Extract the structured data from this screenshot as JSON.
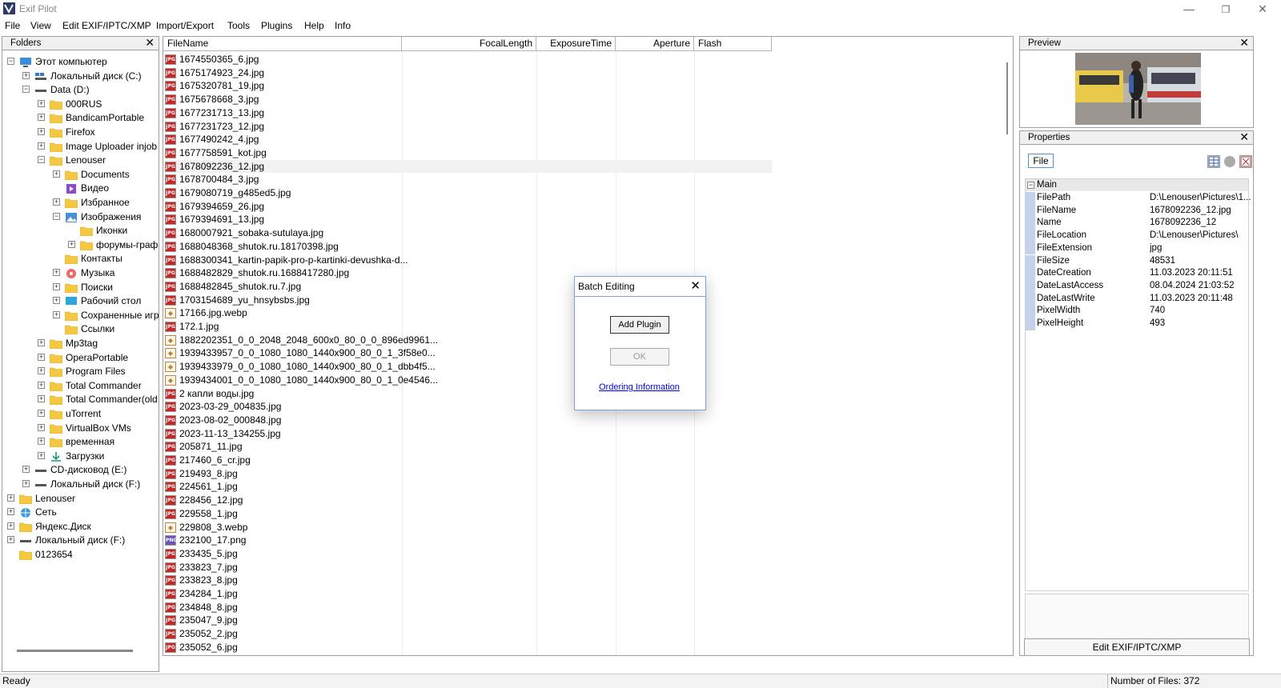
{
  "window": {
    "title": "Exif Pilot"
  },
  "menu": [
    "File",
    "View",
    "Edit EXIF/IPTC/XMP",
    "Import/Export",
    "Tools",
    "Plugins",
    "Help",
    "Info"
  ],
  "folders": {
    "title": "Folders",
    "tree": [
      {
        "label": "Этот компьютер",
        "level": 0,
        "exp": "-",
        "icon": "computer"
      },
      {
        "label": "Локальный диск (C:)",
        "level": 1,
        "exp": "+",
        "icon": "drive-c"
      },
      {
        "label": "Data (D:)",
        "level": 1,
        "exp": "-",
        "icon": "drive"
      },
      {
        "label": "000RUS",
        "level": 2,
        "exp": "+",
        "icon": "folder"
      },
      {
        "label": "BandicamPortable",
        "level": 2,
        "exp": "+",
        "icon": "folder"
      },
      {
        "label": "Firefox",
        "level": 2,
        "exp": "+",
        "icon": "folder"
      },
      {
        "label": "Image Uploader injob",
        "level": 2,
        "exp": "+",
        "icon": "folder"
      },
      {
        "label": "Lenouser",
        "level": 2,
        "exp": "-",
        "icon": "folder"
      },
      {
        "label": "Documents",
        "level": 3,
        "exp": "+",
        "icon": "folder"
      },
      {
        "label": "Видео",
        "level": 3,
        "exp": "",
        "icon": "video"
      },
      {
        "label": "Избранное",
        "level": 3,
        "exp": "+",
        "icon": "folder"
      },
      {
        "label": "Изображения",
        "level": 3,
        "exp": "-",
        "icon": "pictures"
      },
      {
        "label": "Иконки",
        "level": 4,
        "exp": "",
        "icon": "folder"
      },
      {
        "label": "форумы-граф",
        "level": 4,
        "exp": "+",
        "icon": "folder"
      },
      {
        "label": "Контакты",
        "level": 3,
        "exp": "",
        "icon": "folder"
      },
      {
        "label": "Музыка",
        "level": 3,
        "exp": "+",
        "icon": "music"
      },
      {
        "label": "Поиски",
        "level": 3,
        "exp": "+",
        "icon": "folder"
      },
      {
        "label": "Рабочий стол",
        "level": 3,
        "exp": "+",
        "icon": "desktop"
      },
      {
        "label": "Сохраненные игр",
        "level": 3,
        "exp": "+",
        "icon": "folder"
      },
      {
        "label": "Ссылки",
        "level": 3,
        "exp": "",
        "icon": "folder"
      },
      {
        "label": "Mp3tag",
        "level": 2,
        "exp": "+",
        "icon": "folder"
      },
      {
        "label": "OperaPortable",
        "level": 2,
        "exp": "+",
        "icon": "folder"
      },
      {
        "label": "Program Files",
        "level": 2,
        "exp": "+",
        "icon": "folder"
      },
      {
        "label": "Total Commander",
        "level": 2,
        "exp": "+",
        "icon": "folder"
      },
      {
        "label": "Total Commander(old",
        "level": 2,
        "exp": "+",
        "icon": "folder"
      },
      {
        "label": "uTorrent",
        "level": 2,
        "exp": "+",
        "icon": "folder"
      },
      {
        "label": "VirtualBox VMs",
        "level": 2,
        "exp": "+",
        "icon": "folder"
      },
      {
        "label": "временная",
        "level": 2,
        "exp": "+",
        "icon": "folder"
      },
      {
        "label": "Загрузки",
        "level": 2,
        "exp": "+",
        "icon": "download"
      },
      {
        "label": "CD-дисковод (E:)",
        "level": 1,
        "exp": "+",
        "icon": "drive"
      },
      {
        "label": "Локальный диск (F:)",
        "level": 1,
        "exp": "+",
        "icon": "drive"
      },
      {
        "label": "Lenouser",
        "level": 0,
        "exp": "+",
        "icon": "folder"
      },
      {
        "label": "Сеть",
        "level": 0,
        "exp": "+",
        "icon": "network"
      },
      {
        "label": "Яндекс.Диск",
        "level": 0,
        "exp": "+",
        "icon": "folder"
      },
      {
        "label": "Локальный диск (F:)",
        "level": 0,
        "exp": "+",
        "icon": "drive"
      },
      {
        "label": "0123654",
        "level": 0,
        "exp": "",
        "icon": "folder"
      }
    ]
  },
  "files": {
    "columns": [
      "FileName",
      "FocalLength",
      "ExposureTime",
      "Aperture",
      "Flash"
    ],
    "rows": [
      {
        "name": "1674550365_6.jpg",
        "type": "jpg"
      },
      {
        "name": "1675174923_24.jpg",
        "type": "jpg"
      },
      {
        "name": "1675320781_19.jpg",
        "type": "jpg"
      },
      {
        "name": "1675678668_3.jpg",
        "type": "jpg"
      },
      {
        "name": "1677231713_13.jpg",
        "type": "jpg"
      },
      {
        "name": "1677231723_12.jpg",
        "type": "jpg"
      },
      {
        "name": "1677490242_4.jpg",
        "type": "jpg"
      },
      {
        "name": "1677758591_kot.jpg",
        "type": "jpg"
      },
      {
        "name": "1678092236_12.jpg",
        "type": "jpg",
        "selected": true
      },
      {
        "name": "1678700484_3.jpg",
        "type": "jpg"
      },
      {
        "name": "1679080719_g485ed5.jpg",
        "type": "jpg"
      },
      {
        "name": "1679394659_26.jpg",
        "type": "jpg"
      },
      {
        "name": "1679394691_13.jpg",
        "type": "jpg"
      },
      {
        "name": "1680007921_sobaka-sutulaya.jpg",
        "type": "jpg"
      },
      {
        "name": "1688048368_shutok.ru.18170398.jpg",
        "type": "jpg"
      },
      {
        "name": "1688300341_kartin-papik-pro-p-kartinki-devushka-d...",
        "type": "jpg"
      },
      {
        "name": "1688482829_shutok.ru.1688417280.jpg",
        "type": "jpg"
      },
      {
        "name": "1688482845_shutok.ru.7.jpg",
        "type": "jpg"
      },
      {
        "name": "1703154689_yu_hnsybsbs.jpg",
        "type": "jpg"
      },
      {
        "name": "17166.jpg.webp",
        "type": "webp"
      },
      {
        "name": "172.1.jpg",
        "type": "jpg"
      },
      {
        "name": "1882202351_0_0_2048_2048_600x0_80_0_0_896ed9961...",
        "type": "webp"
      },
      {
        "name": "1939433957_0_0_1080_1080_1440x900_80_0_1_3f58e0...",
        "type": "webp"
      },
      {
        "name": "1939433979_0_0_1080_1080_1440x900_80_0_1_dbb4f5...",
        "type": "webp"
      },
      {
        "name": "1939434001_0_0_1080_1080_1440x900_80_0_1_0e4546...",
        "type": "webp"
      },
      {
        "name": "2 капли воды.jpg",
        "type": "jpg"
      },
      {
        "name": "2023-03-29_004835.jpg",
        "type": "jpg"
      },
      {
        "name": "2023-08-02_000848.jpg",
        "type": "jpg"
      },
      {
        "name": "2023-11-13_134255.jpg",
        "type": "jpg"
      },
      {
        "name": "205871_11.jpg",
        "type": "jpg"
      },
      {
        "name": "217460_6_cr.jpg",
        "type": "jpg"
      },
      {
        "name": "219493_8.jpg",
        "type": "jpg"
      },
      {
        "name": "224561_1.jpg",
        "type": "jpg"
      },
      {
        "name": "228456_12.jpg",
        "type": "jpg"
      },
      {
        "name": "229558_1.jpg",
        "type": "jpg"
      },
      {
        "name": "229808_3.webp",
        "type": "webp"
      },
      {
        "name": "232100_17.png",
        "type": "png"
      },
      {
        "name": "233435_5.jpg",
        "type": "jpg"
      },
      {
        "name": "233823_7.jpg",
        "type": "jpg"
      },
      {
        "name": "233823_8.jpg",
        "type": "jpg"
      },
      {
        "name": "234284_1.jpg",
        "type": "jpg"
      },
      {
        "name": "234848_8.jpg",
        "type": "jpg"
      },
      {
        "name": "235047_9.jpg",
        "type": "jpg"
      },
      {
        "name": "235052_2.jpg",
        "type": "jpg"
      },
      {
        "name": "235052_6.jpg",
        "type": "jpg"
      }
    ]
  },
  "preview": {
    "title": "Preview"
  },
  "properties": {
    "title": "Properties",
    "tab": "File",
    "section": "Main",
    "rows": [
      {
        "key": "FilePath",
        "value": "D:\\Lenouser\\Pictures\\1..."
      },
      {
        "key": "FileName",
        "value": "1678092236_12.jpg"
      },
      {
        "key": "Name",
        "value": "1678092236_12"
      },
      {
        "key": "FileLocation",
        "value": "D:\\Lenouser\\Pictures\\"
      },
      {
        "key": "FileExtension",
        "value": "jpg"
      },
      {
        "key": "FileSize",
        "value": "48531"
      },
      {
        "key": "DateCreation",
        "value": "11.03.2023 20:11:51"
      },
      {
        "key": "DateLastAccess",
        "value": "08.04.2024 21:03:52"
      },
      {
        "key": "DateLastWrite",
        "value": "11.03.2023 20:11:48"
      },
      {
        "key": "PixelWidth",
        "value": "740"
      },
      {
        "key": "PixelHeight",
        "value": "493"
      }
    ],
    "edit_button": "Edit EXIF/IPTC/XMP"
  },
  "status": {
    "left": "Ready",
    "right": "Number of Files: 372"
  },
  "dialog": {
    "title": "Batch Editing",
    "add_plugin": "Add Plugin",
    "ok": "OK",
    "link": "Ordering Information"
  },
  "icons": {
    "folder_color": "#f4c842",
    "jpg_color": "#c62828",
    "accent": "#7ca4dc"
  }
}
